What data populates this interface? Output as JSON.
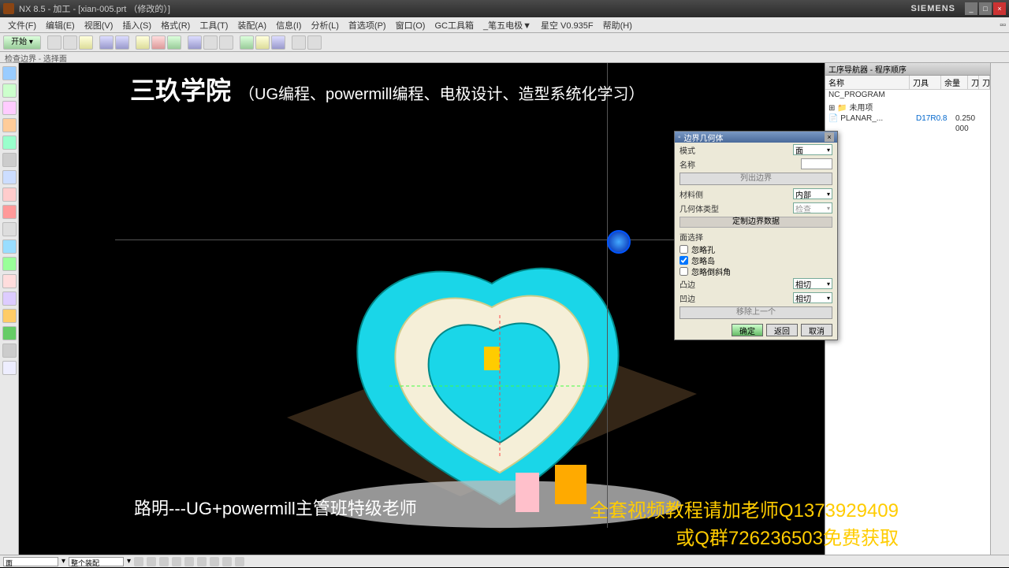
{
  "titlebar": {
    "app": "NX 8.5 - 加工 - [xian-005.prt （修改的）]",
    "brand": "SIEMENS"
  },
  "menu": {
    "items": [
      "文件(F)",
      "编辑(E)",
      "视图(V)",
      "插入(S)",
      "格式(R)",
      "工具(T)",
      "装配(A)",
      "信息(I)",
      "分析(L)",
      "首选项(P)",
      "窗口(O)",
      "GC工具箱",
      "_笔五电极▼",
      "星空 V0.935F",
      "帮助(H)"
    ],
    "start": "开始 ▾"
  },
  "status": {
    "prompt": "检查边界 - 选择面"
  },
  "nav": {
    "title": "工序导航器 - 程序顺序",
    "cols": [
      "名称",
      "刀具",
      "余量",
      "刀",
      "刀"
    ],
    "rows": [
      {
        "name": "NC_PROGRAM",
        "tool": "",
        "yl": ""
      },
      {
        "name": "⊞ 📁 未用项",
        "tool": "",
        "yl": ""
      },
      {
        "name": "  📄 PLANAR_...",
        "tool": "D17R0.8",
        "yl": "0.250"
      },
      {
        "name": "",
        "tool": "",
        "yl": "000"
      }
    ]
  },
  "dialog": {
    "title": "边界几何体",
    "mode_label": "模式",
    "mode_value": "面",
    "name_label": "名称",
    "list_btn": "列出边界",
    "material_label": "材料侧",
    "material_value": "内部",
    "geotype_label": "几何体类型",
    "geotype_value": "检查",
    "custom_btn": "定制边界数据",
    "facesel_label": "面选择",
    "chk1": "忽略孔",
    "chk2": "忽略岛",
    "chk3": "忽略倒斜角",
    "convex_label": "凸边",
    "convex_value": "相切",
    "concave_label": "凹边",
    "concave_value": "相切",
    "remove_btn": "移除上一个",
    "ok": "确定",
    "back": "返回",
    "cancel": "取消"
  },
  "overlay": {
    "title_main": "三玖学院",
    "title_sub": "（UG编程、powermill编程、电极设计、造型系统化学习）",
    "teacher": "路明---UG+powermill主管班特级老师",
    "promo1": "全套视频教程请加老师Q1373929409",
    "promo2": "或Q群726236503免费获取"
  },
  "bottom": {
    "sel1": "面",
    "sel2": "整个装配"
  }
}
